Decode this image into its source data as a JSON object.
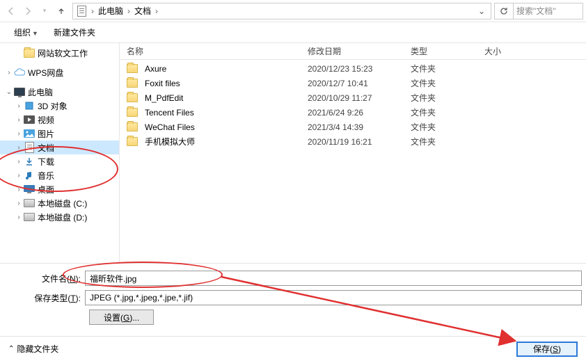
{
  "nav": {
    "breadcrumb": [
      "此电脑",
      "文档"
    ],
    "search_placeholder": "搜索\"文档\""
  },
  "toolbar": {
    "organize": "组织",
    "new_folder": "新建文件夹"
  },
  "sidebar": {
    "items": [
      {
        "label": "网站软文工作",
        "icon": "folder",
        "indent": 1,
        "expand": ""
      },
      {
        "label": "",
        "spacer": true
      },
      {
        "label": "WPS网盘",
        "icon": "cloud",
        "indent": 0,
        "expand": ">"
      },
      {
        "label": "",
        "spacer": true
      },
      {
        "label": "此电脑",
        "icon": "pc",
        "indent": 0,
        "expand": "v"
      },
      {
        "label": "3D 对象",
        "icon": "3d",
        "indent": 1,
        "expand": ">"
      },
      {
        "label": "视频",
        "icon": "video",
        "indent": 1,
        "expand": ">"
      },
      {
        "label": "图片",
        "icon": "pic",
        "indent": 1,
        "expand": ">"
      },
      {
        "label": "文档",
        "icon": "doc",
        "indent": 1,
        "expand": ">",
        "selected": true
      },
      {
        "label": "下载",
        "icon": "down",
        "indent": 1,
        "expand": ">"
      },
      {
        "label": "音乐",
        "icon": "music",
        "indent": 1,
        "expand": ">"
      },
      {
        "label": "桌面",
        "icon": "desktop",
        "indent": 1,
        "expand": ">"
      },
      {
        "label": "本地磁盘 (C:)",
        "icon": "disk",
        "indent": 1,
        "expand": ">"
      },
      {
        "label": "本地磁盘 (D:)",
        "icon": "disk",
        "indent": 1,
        "expand": ">"
      }
    ]
  },
  "columns": {
    "name": "名称",
    "date": "修改日期",
    "type": "类型",
    "size": "大小"
  },
  "files": [
    {
      "name": "Axure",
      "date": "2020/12/23 15:23",
      "type": "文件夹"
    },
    {
      "name": "Foxit files",
      "date": "2020/12/7 10:41",
      "type": "文件夹"
    },
    {
      "name": "M_PdfEdit",
      "date": "2020/10/29 11:27",
      "type": "文件夹"
    },
    {
      "name": "Tencent Files",
      "date": "2021/6/24 9:26",
      "type": "文件夹"
    },
    {
      "name": "WeChat Files",
      "date": "2021/3/4 14:39",
      "type": "文件夹"
    },
    {
      "name": "手机模拟大师",
      "date": "2020/11/19 16:21",
      "type": "文件夹"
    }
  ],
  "form": {
    "filename_label_pre": "文件名(",
    "filename_label_u": "N",
    "filename_label_post": "):",
    "filename_value": "福昕软件.jpg",
    "type_label_pre": "保存类型(",
    "type_label_u": "T",
    "type_label_post": "):",
    "type_value": "JPEG (*.jpg,*.jpeg,*.jpe,*.jif)",
    "settings_pre": "设置(",
    "settings_u": "G",
    "settings_post": ")..."
  },
  "footer": {
    "hide_folders": "隐藏文件夹",
    "save_pre": "保存(",
    "save_u": "S",
    "save_post": ")"
  }
}
